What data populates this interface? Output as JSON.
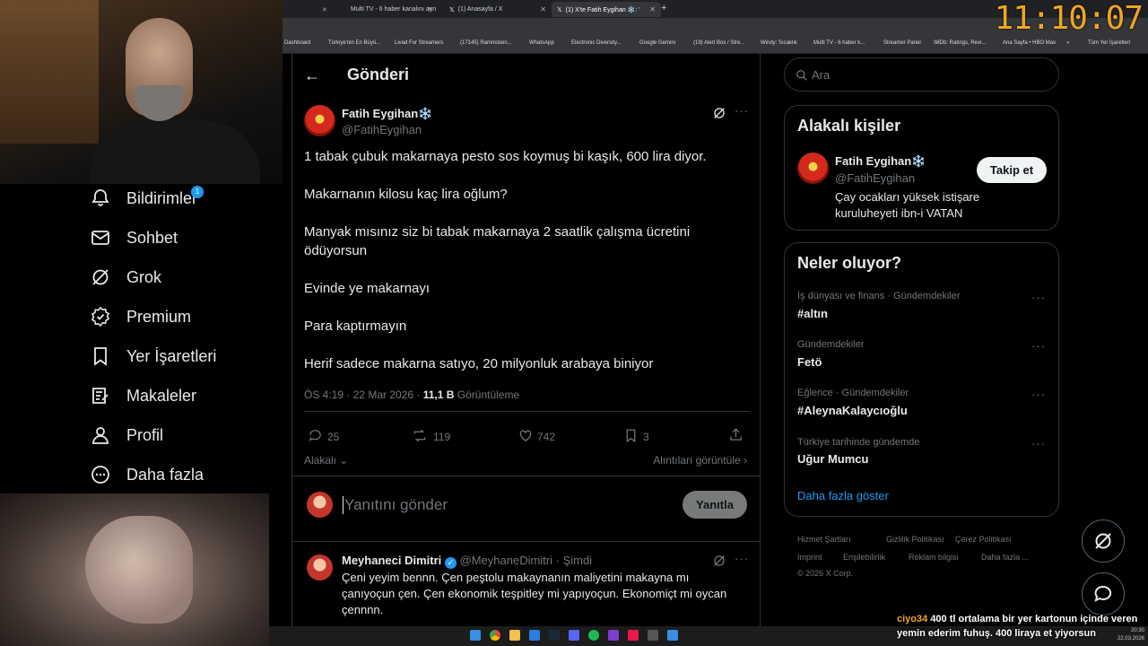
{
  "browser": {
    "tabs": [
      {
        "label": "Multi TV - 6 haber kanalını ayn"
      },
      {
        "label": "(1) Anasayfa / X"
      },
      {
        "label": "(1) X'te Fatih Eygihan ❄️: \"1 tab"
      }
    ],
    "bookmarks": [
      "Dashboard",
      "Türkiye'nin En Büyü...",
      "Livad For Streamers",
      "(17145) Rammstein...",
      "WhatsApp",
      "Electronic Diversity...",
      "Google Gemini",
      "(19) Alert Box / Stre...",
      "Windy: Sıcaklık",
      "Multi TV - 6 haber k...",
      "Streamer Panel",
      "IMDb: Ratings, Revi...",
      "Ana Sayfa • HBO Max",
      "»",
      "Tüm Yer İşaretleri"
    ]
  },
  "overlay": {
    "clock": "11:10:07"
  },
  "sidebar": {
    "notif_count": "1",
    "items": [
      {
        "label": "Bildirimler",
        "icon": "bell-icon"
      },
      {
        "label": "Sohbet",
        "icon": "mail-icon"
      },
      {
        "label": "Grok",
        "icon": "grok-icon"
      },
      {
        "label": "Premium",
        "icon": "verified-icon"
      },
      {
        "label": "Yer İşaretleri",
        "icon": "bookmark-icon"
      },
      {
        "label": "Makaleler",
        "icon": "article-icon"
      },
      {
        "label": "Profil",
        "icon": "person-icon"
      },
      {
        "label": "Daha fazla",
        "icon": "more-circle-icon"
      }
    ]
  },
  "post": {
    "header_title": "Gönderi",
    "author_name": "Fatih Eygihan❄️",
    "author_handle": "@FatihEygihan",
    "lines": [
      "1 tabak  çubuk makarnaya pesto sos koymuş bi kaşık, 600 lira diyor.",
      "Makarnanın kilosu kaç lira oğlum?",
      "Manyak mısınız siz  bi tabak makarnaya 2 saatlik çalışma ücretini ödüyorsun",
      "Evinde ye makarnayı",
      "Para kaptırmayın",
      "Herif sadece makarna satıyo, 20 milyonluk arabaya biniyor"
    ],
    "timestamp": "ÖS 4:19 · 22 Mar 2026 · ",
    "views_count": "11,1 B",
    "views_label": " Görüntüleme",
    "replies": "25",
    "reposts": "119",
    "likes": "742",
    "bookmarks": "3",
    "relevant_label": "Alakalı",
    "quotes_label": "Alıntıları görüntüle",
    "reply_placeholder": "Yanıtını gönder",
    "reply_button": "Yanıtla"
  },
  "reply": {
    "author_name": "Meyhaneci Dimitri",
    "author_handle": "@MeyhaneDimitri · Şimdi",
    "text": "Çeni yeyim bennn. Çen peştolu makaynanın maliyetini makayna mı çanıyoçun çen. Çen ekonomik teşpitley mi yapıyoçun. Ekonomiçt mi oycan çennnn."
  },
  "right": {
    "search_placeholder": "Ara",
    "related_title": "Alakalı kişiler",
    "related_name": "Fatih Eygihan❄️",
    "related_handle": "@FatihEygihan",
    "related_bio": "Çay ocakları yüksek istişare kuruluheyeti ibn-i VATAN",
    "follow_button": "Takip et",
    "trending_title": "Neler oluyor?",
    "trends": [
      {
        "meta": "İş dünyası ve finans · Gündemdekiler",
        "title": "#altın"
      },
      {
        "meta": "Gündemdekiler",
        "title": "Fetö"
      },
      {
        "meta": "Eğlence · Gündemdekiler",
        "title": "#AleynaKalaycıoğlu"
      },
      {
        "meta": "Türkiye tarihinde gündemde",
        "title": "Uğur Mumcu"
      }
    ],
    "show_more": "Daha fazla göster",
    "footer": [
      "Hizmet Şartları",
      "Gizlilik Politikası",
      "Çerez Politikası",
      "Imprint",
      "Erişilebilirlik",
      "Reklam bilgisi",
      "Daha fazla ...",
      "© 2026 X Corp."
    ]
  },
  "chat": {
    "user": "ciyo34",
    "message": "400 tl ortalama bir yer kartonun içinde veren yemin ederim fuhuş. 400 liraya et yiyorsun"
  },
  "taskbar": {
    "time": "20:30",
    "date": "22.03.2026"
  },
  "colors": {
    "accent": "#1d9bf0",
    "clock": "#f0a623",
    "chat_user": "#f0a623"
  }
}
